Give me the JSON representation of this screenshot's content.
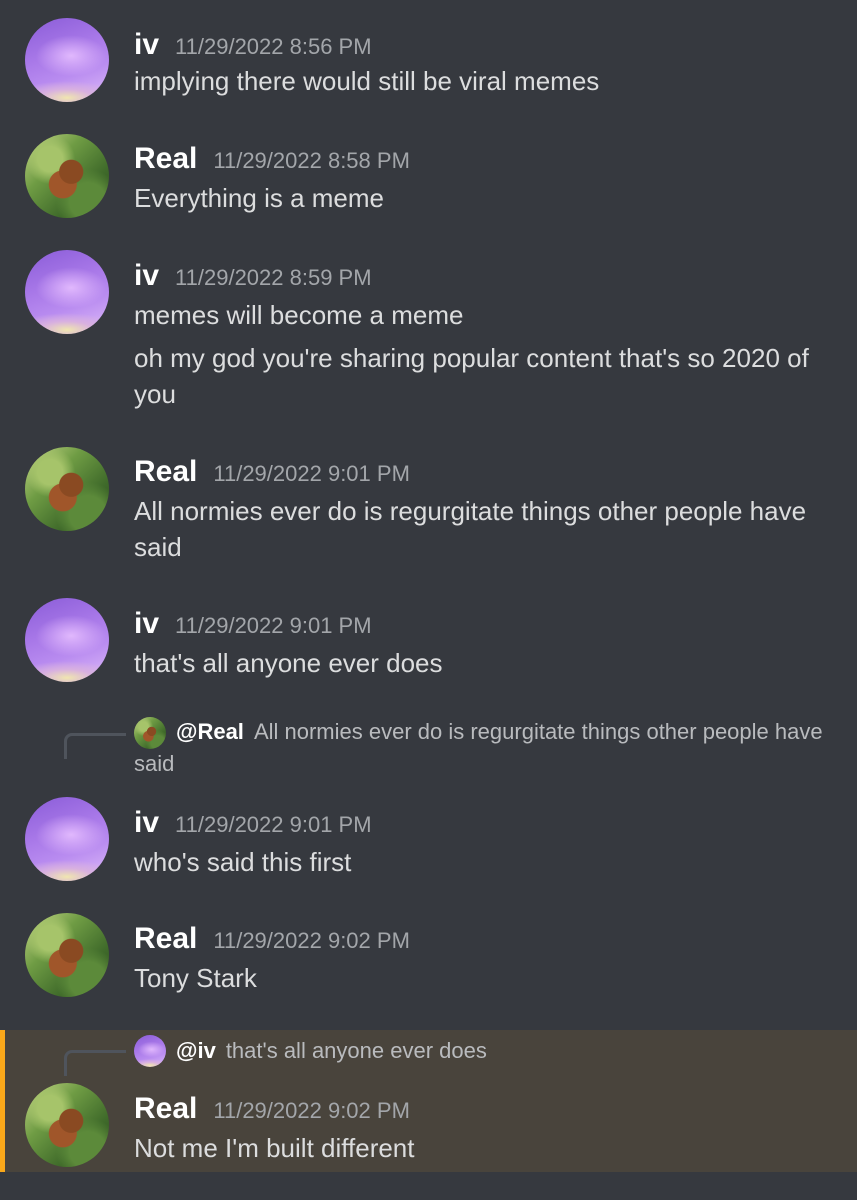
{
  "messages": [
    {
      "author": "iv",
      "timestamp": "11/29/2022 8:56 PM",
      "lines": [
        "implying there would still be viral memes"
      ]
    },
    {
      "author": "Real",
      "timestamp": "11/29/2022 8:58 PM",
      "lines": [
        "Everything is a meme"
      ]
    },
    {
      "author": "iv",
      "timestamp": "11/29/2022 8:59 PM",
      "lines": [
        "memes will become a meme",
        "oh my god you're sharing popular content that's so 2020 of you"
      ]
    },
    {
      "author": "Real",
      "timestamp": "11/29/2022 9:01 PM",
      "lines": [
        "All normies ever do is regurgitate things other people have said"
      ]
    },
    {
      "author": "iv",
      "timestamp": "11/29/2022 9:01 PM",
      "lines": [
        "that's all anyone ever does"
      ]
    },
    {
      "author": "iv",
      "timestamp": "11/29/2022 9:01 PM",
      "lines": [
        "who's said this first"
      ],
      "reply": {
        "mention": "@Real",
        "text": "All normies ever do is regurgitate things other people have said"
      }
    },
    {
      "author": "Real",
      "timestamp": "11/29/2022 9:02 PM",
      "lines": [
        "Tony Stark"
      ]
    },
    {
      "author": "Real",
      "timestamp": "11/29/2022 9:02 PM",
      "lines": [
        "Not me I'm built different"
      ],
      "reply": {
        "mention": "@iv",
        "text": "that's all anyone ever does"
      }
    }
  ]
}
